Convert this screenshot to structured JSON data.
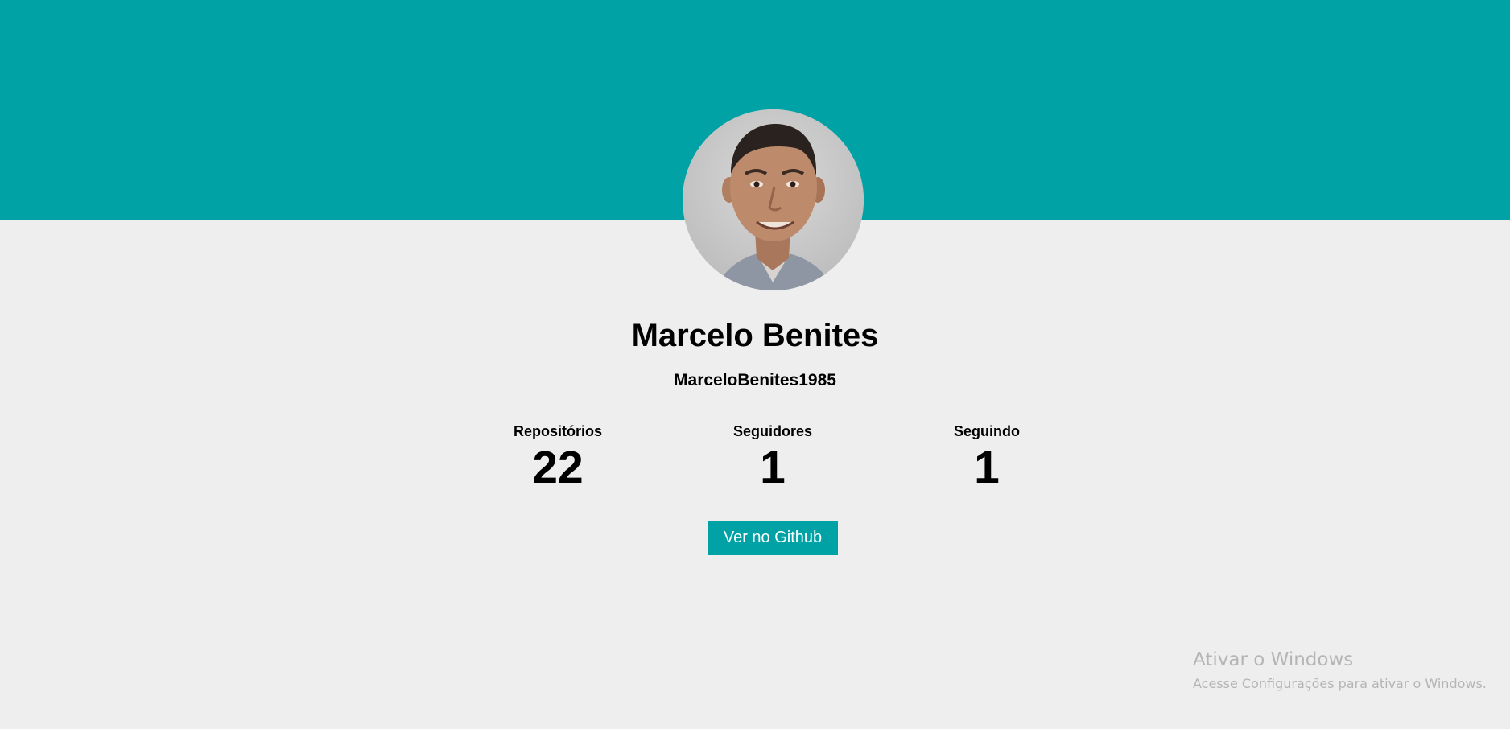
{
  "profile": {
    "name": "Marcelo Benites",
    "username": "MarceloBenites1985",
    "avatar_icon": "user-photo"
  },
  "stats": {
    "repositories": {
      "label": "Repositórios",
      "value": "22"
    },
    "followers": {
      "label": "Seguidores",
      "value": "1"
    },
    "following": {
      "label": "Seguindo",
      "value": "1"
    }
  },
  "actions": {
    "github_button_label": "Ver no Github"
  },
  "windows_watermark": {
    "title": "Ativar o Windows",
    "subtitle": "Acesse Configurações para ativar o Windows."
  },
  "colors": {
    "accent": "#00a2a6",
    "background": "#eeeeee",
    "text": "#000000",
    "watermark": "#b5b5b5"
  }
}
